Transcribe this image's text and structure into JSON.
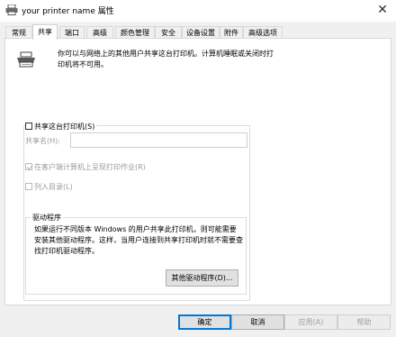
{
  "window": {
    "title": "your printer name 属性",
    "close_glyph": "✕"
  },
  "tabs": [
    {
      "label": "常规",
      "active": false
    },
    {
      "label": "共享",
      "active": true
    },
    {
      "label": "端口",
      "active": false
    },
    {
      "label": "高级",
      "active": false
    },
    {
      "label": "颜色管理",
      "active": false
    },
    {
      "label": "安全",
      "active": false
    },
    {
      "label": "设备设置",
      "active": false
    },
    {
      "label": "附件",
      "active": false
    },
    {
      "label": "高级选项",
      "active": false
    }
  ],
  "sharing": {
    "info_text": "你可以与网络上的其他用户共享这台打印机。计算机睡眠或关闭时打印机将不可用。",
    "share_checkbox_label": "共享这台打印机(S)",
    "share_checked": false,
    "share_name_label": "共享名(H):",
    "share_name_value": "",
    "render_jobs_label": "在客户端计算机上呈现打印作业(R)",
    "render_jobs_checked": true,
    "list_in_directory_label": "列入目录(L)",
    "list_in_directory_checked": false
  },
  "drivers": {
    "group_label": "驱动程序",
    "description": "如果运行不同版本 Windows 的用户共享此打印机，则可能需要安装其他驱动程序。这样，当用户连接到共享打印机时就不需要查找打印机驱动程序。",
    "button_label": "其他驱动程序(D)..."
  },
  "footer": {
    "ok_label": "确定",
    "cancel_label": "取消",
    "apply_label": "应用(A)",
    "help_label": "帮助"
  }
}
